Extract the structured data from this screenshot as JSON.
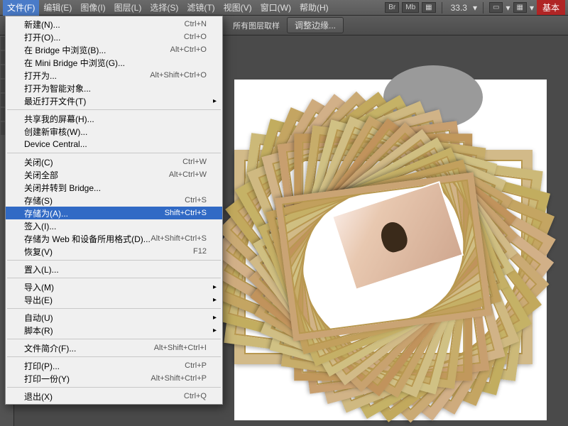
{
  "menubar": {
    "items": [
      "文件(F)",
      "编辑(E)",
      "图像(I)",
      "图层(L)",
      "选择(S)",
      "滤镜(T)",
      "视图(V)",
      "窗口(W)",
      "帮助(H)"
    ],
    "right_btns": [
      "Br",
      "Mb",
      "▦"
    ],
    "zoom": "33.3",
    "arrow": "▾",
    "basic": "基本"
  },
  "optbar": {
    "sample": "所有图层取样",
    "refine": "调整边缘..."
  },
  "dropdown": {
    "items": [
      {
        "label": "新建(N)...",
        "shortcut": "Ctrl+N"
      },
      {
        "label": "打开(O)...",
        "shortcut": "Ctrl+O"
      },
      {
        "label": "在 Bridge 中浏览(B)...",
        "shortcut": "Alt+Ctrl+O"
      },
      {
        "label": "在 Mini Bridge 中浏览(G)..."
      },
      {
        "label": "打开为...",
        "shortcut": "Alt+Shift+Ctrl+O"
      },
      {
        "label": "打开为智能对象..."
      },
      {
        "label": "最近打开文件(T)",
        "sub": true
      },
      {
        "sep": true
      },
      {
        "label": "共享我的屏幕(H)..."
      },
      {
        "label": "创建新审核(W)..."
      },
      {
        "label": "Device Central..."
      },
      {
        "sep": true
      },
      {
        "label": "关闭(C)",
        "shortcut": "Ctrl+W"
      },
      {
        "label": "关闭全部",
        "shortcut": "Alt+Ctrl+W"
      },
      {
        "label": "关闭并转到 Bridge..."
      },
      {
        "label": "存储(S)",
        "shortcut": "Ctrl+S"
      },
      {
        "label": "存储为(A)...",
        "shortcut": "Shift+Ctrl+S",
        "hl": true
      },
      {
        "label": "签入(I)..."
      },
      {
        "label": "存储为 Web 和设备所用格式(D)...",
        "shortcut": "Alt+Shift+Ctrl+S"
      },
      {
        "label": "恢复(V)",
        "shortcut": "F12"
      },
      {
        "sep": true
      },
      {
        "label": "置入(L)..."
      },
      {
        "sep": true
      },
      {
        "label": "导入(M)",
        "sub": true
      },
      {
        "label": "导出(E)",
        "sub": true
      },
      {
        "sep": true
      },
      {
        "label": "自动(U)",
        "sub": true
      },
      {
        "label": "脚本(R)",
        "sub": true
      },
      {
        "sep": true
      },
      {
        "label": "文件简介(F)...",
        "shortcut": "Alt+Shift+Ctrl+I"
      },
      {
        "sep": true
      },
      {
        "label": "打印(P)...",
        "shortcut": "Ctrl+P"
      },
      {
        "label": "打印一份(Y)",
        "shortcut": "Alt+Shift+Ctrl+P"
      },
      {
        "sep": true
      },
      {
        "label": "退出(X)",
        "shortcut": "Ctrl+Q"
      }
    ]
  }
}
